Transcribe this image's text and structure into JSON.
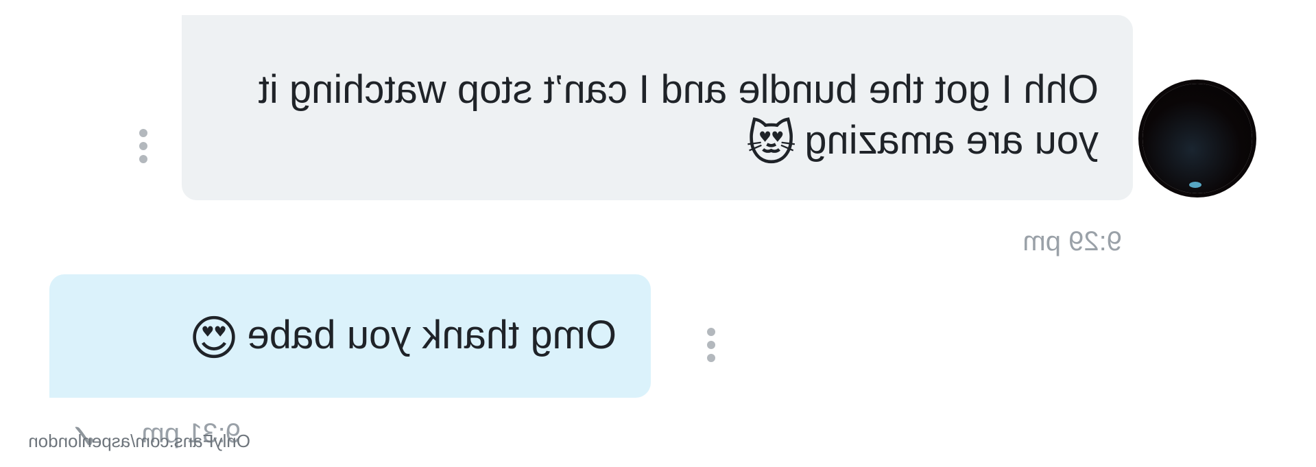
{
  "messages": [
    {
      "side": "received",
      "text": "Ohh I got the bundle and I can’t stop watching it you are amazing",
      "emoji": "😻",
      "emoji_name": "smiling-cat-heart-eyes",
      "time": "9:29 pm"
    },
    {
      "side": "sent",
      "text": "Omg thank you babe",
      "emoji": "😍",
      "emoji_name": "heart-eyes",
      "time": "9:31 pm",
      "status_icon": "check-icon"
    }
  ],
  "watermark": "OnlyFans.com/aspenlondon",
  "colors": {
    "received_bubble": "#eef1f3",
    "sent_bubble": "#dbf2fb",
    "timestamp": "#9aa1a8"
  },
  "mirrored": true
}
